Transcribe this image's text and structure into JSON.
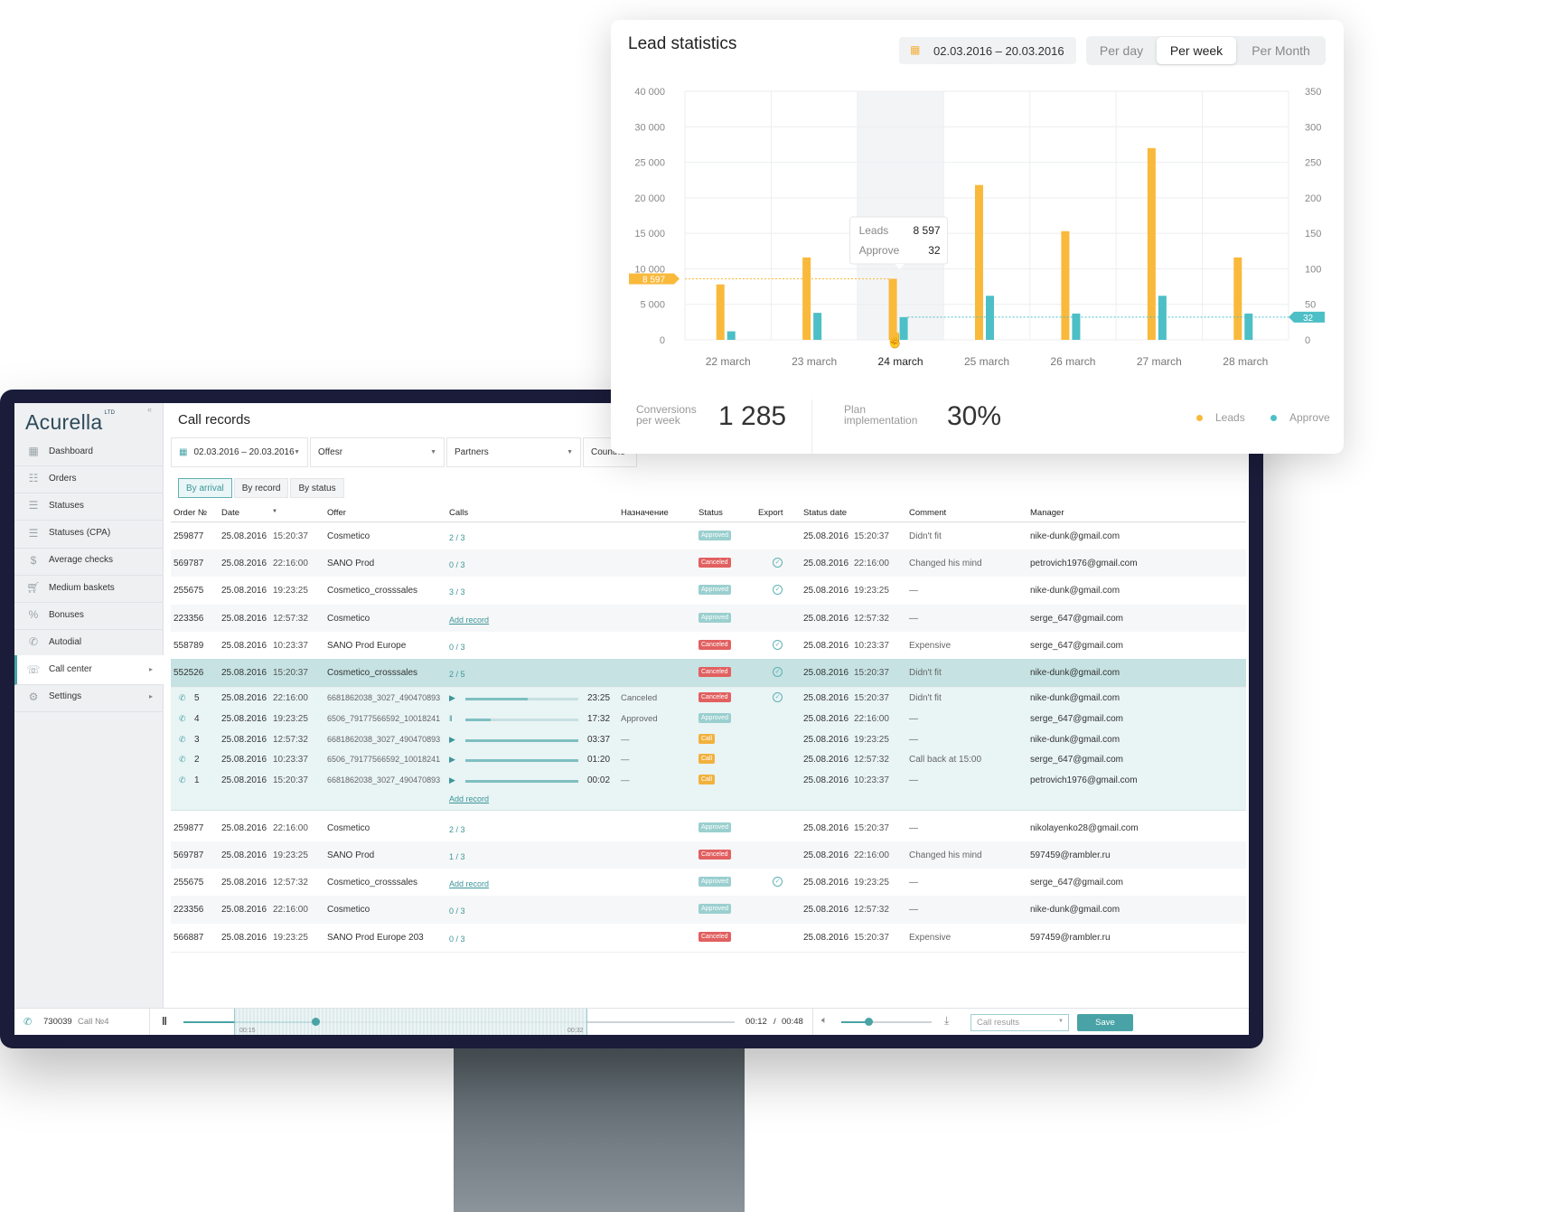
{
  "app": {
    "logo": "Acurella",
    "logo_sup": "LTD"
  },
  "sidebar": {
    "items": [
      {
        "label": "Dashboard",
        "icon": "grid-icon"
      },
      {
        "label": "Orders",
        "icon": "list-icon"
      },
      {
        "label": "Statuses",
        "icon": "lines-icon"
      },
      {
        "label": "Statuses (CPA)",
        "icon": "lines-icon"
      },
      {
        "label": "Average checks",
        "icon": "dollar-icon"
      },
      {
        "label": "Medium baskets",
        "icon": "cart-icon"
      },
      {
        "label": "Bonuses",
        "icon": "percent-icon"
      },
      {
        "label": "Autodial",
        "icon": "phone-icon"
      },
      {
        "label": "Call center",
        "icon": "headset-icon"
      },
      {
        "label": "Settings",
        "icon": "gear-icon"
      }
    ]
  },
  "page": {
    "title": "Call records"
  },
  "filters": {
    "date": "02.03.2016 – 20.03.2016",
    "offer": "Offesr",
    "partners": "Partners",
    "countries": "Countrie"
  },
  "tabs": [
    "By arrival",
    "By record",
    "By status"
  ],
  "table": {
    "headers": [
      "Order №",
      "Date",
      "Offer",
      "Calls",
      "Назначение",
      "Status",
      "Export",
      "Status date",
      "Comment",
      "Manager"
    ],
    "rows": [
      {
        "id": "259877",
        "date": "25.08.2016",
        "time": "15:20:37",
        "offer": "Cosmetico",
        "calls": "2 / 3",
        "status": "Approved",
        "export": false,
        "sdate": "25.08.2016",
        "stime": "15:20:37",
        "comment": "Didn't fit",
        "manager": "nike-dunk@gmail.com"
      },
      {
        "id": "569787",
        "date": "25.08.2016",
        "time": "22:16:00",
        "offer": "SANO Prod",
        "calls": "0 / 3",
        "status": "Canceled",
        "export": true,
        "sdate": "25.08.2016",
        "stime": "22:16:00",
        "comment": "Changed his mind",
        "manager": "petrovich1976@gmail.com"
      },
      {
        "id": "255675",
        "date": "25.08.2016",
        "time": "19:23:25",
        "offer": "Cosmetico_crosssales",
        "calls": "3 / 3",
        "status": "Approved",
        "export": true,
        "sdate": "25.08.2016",
        "stime": "19:23:25",
        "comment": "—",
        "manager": "nike-dunk@gmail.com"
      },
      {
        "id": "223356",
        "date": "25.08.2016",
        "time": "12:57:32",
        "offer": "Cosmetico",
        "calls": "Add record",
        "status": "Approved",
        "export": false,
        "sdate": "25.08.2016",
        "stime": "12:57:32",
        "comment": "—",
        "manager": "serge_647@gmail.com"
      },
      {
        "id": "558789",
        "date": "25.08.2016",
        "time": "10:23:37",
        "offer": "SANO Prod Europe",
        "calls": "0 / 3",
        "status": "Canceled",
        "export": true,
        "sdate": "25.08.2016",
        "stime": "10:23:37",
        "comment": "Expensive",
        "manager": "serge_647@gmail.com"
      },
      {
        "id": "552526",
        "date": "25.08.2016",
        "time": "15:20:37",
        "offer": "Cosmetico_crosssales",
        "calls": "2 / 5",
        "status": "Canceled",
        "export": true,
        "sdate": "25.08.2016",
        "stime": "15:20:37",
        "comment": "Didn't fit",
        "manager": "nike-dunk@gmail.com"
      }
    ],
    "subrows": [
      {
        "n": "5",
        "date": "25.08.2016",
        "time": "22:16:00",
        "file": "6681862038_3027_490470893",
        "dur": "23:25",
        "result": "Canceled",
        "status": "Canceled",
        "export": true,
        "sdate": "25.08.2016",
        "stime": "15:20:37",
        "comment": "Didn't fit",
        "manager": "nike-dunk@gmail.com",
        "progress": 0.55,
        "playing": false
      },
      {
        "n": "4",
        "date": "25.08.2016",
        "time": "19:23:25",
        "file": "6506_79177566592_10018241",
        "dur": "17:32",
        "result": "Approved",
        "status": "Approved",
        "export": false,
        "sdate": "25.08.2016",
        "stime": "22:16:00",
        "comment": "—",
        "manager": "serge_647@gmail.com",
        "progress": 0.22,
        "playing": true
      },
      {
        "n": "3",
        "date": "25.08.2016",
        "time": "12:57:32",
        "file": "6681862038_3027_490470893",
        "dur": "03:37",
        "result": "—",
        "status": "Call",
        "export": false,
        "sdate": "25.08.2016",
        "stime": "19:23:25",
        "comment": "—",
        "manager": "nike-dunk@gmail.com",
        "progress": 1,
        "playing": false
      },
      {
        "n": "2",
        "date": "25.08.2016",
        "time": "10:23:37",
        "file": "6506_79177566592_10018241",
        "dur": "01:20",
        "result": "—",
        "status": "Call",
        "export": false,
        "sdate": "25.08.2016",
        "stime": "12:57:32",
        "comment": "Call back at 15:00",
        "manager": "serge_647@gmail.com",
        "progress": 1,
        "playing": false
      },
      {
        "n": "1",
        "date": "25.08.2016",
        "time": "15:20:37",
        "file": "6681862038_3027_490470893",
        "dur": "00:02",
        "result": "—",
        "status": "Call",
        "export": false,
        "sdate": "25.08.2016",
        "stime": "10:23:37",
        "comment": "—",
        "manager": "petrovich1976@gmail.com",
        "progress": 1,
        "playing": false
      }
    ],
    "sub_add": "Add record",
    "rows2": [
      {
        "id": "259877",
        "date": "25.08.2016",
        "time": "22:16:00",
        "offer": "Cosmetico",
        "calls": "2 / 3",
        "status": "Approved",
        "export": false,
        "sdate": "25.08.2016",
        "stime": "15:20:37",
        "comment": "—",
        "manager": "nikolayenko28@gmail.com"
      },
      {
        "id": "569787",
        "date": "25.08.2016",
        "time": "19:23:25",
        "offer": "SANO Prod",
        "calls": "1 / 3",
        "status": "Canceled",
        "export": false,
        "sdate": "25.08.2016",
        "stime": "22:16:00",
        "comment": "Changed his mind",
        "manager": "597459@rambler.ru"
      },
      {
        "id": "255675",
        "date": "25.08.2016",
        "time": "12:57:32",
        "offer": "Cosmetico_crosssales",
        "calls": "Add record",
        "status": "Approved",
        "export": true,
        "sdate": "25.08.2016",
        "stime": "19:23:25",
        "comment": "—",
        "manager": "serge_647@gmail.com"
      },
      {
        "id": "223356",
        "date": "25.08.2016",
        "time": "22:16:00",
        "offer": "Cosmetico",
        "calls": "0 / 3",
        "status": "Approved",
        "export": false,
        "sdate": "25.08.2016",
        "stime": "12:57:32",
        "comment": "—",
        "manager": "nike-dunk@gmail.com"
      },
      {
        "id": "566887",
        "date": "25.08.2016",
        "time": "19:23:25",
        "offer": "SANO Prod Europe 203",
        "calls": "0 / 3",
        "status": "Canceled",
        "export": false,
        "sdate": "25.08.2016",
        "stime": "15:20:37",
        "comment": "Expensive",
        "manager": "597459@rambler.ru"
      }
    ]
  },
  "player": {
    "number": "730039",
    "call": "Call №4",
    "current": "00:12",
    "sep": "/",
    "total": "00:48",
    "mark_start": "00:15",
    "mark_end": "00:32",
    "results_placeholder": "Call results",
    "save": "Save",
    "progress": 0.24,
    "volume": 0.3
  },
  "stats_card": {
    "title": "Lead statistics",
    "date_range": "02.03.2016 – 20.03.2016",
    "periods": [
      "Per day",
      "Per week",
      "Per Month"
    ],
    "selected_period": "Per week",
    "conv_label": "Conversions per week",
    "conv_value": "1 285",
    "plan_label": "Plan implementation",
    "plan_value": "30%",
    "tooltip": {
      "leads_label": "Leads",
      "leads_value": "8 597",
      "approve_label": "Approve",
      "approve_value": "32"
    },
    "marker_left": "8 597",
    "marker_right": "32"
  },
  "chart_data": {
    "type": "bar",
    "categories": [
      "22 march",
      "23 march",
      "24 march",
      "25 march",
      "26 march",
      "27 march",
      "28 march"
    ],
    "highlighted": "24 march",
    "series": [
      {
        "name": "Leads",
        "axis": "left",
        "color": "#f9b93b",
        "values": [
          7800,
          11600,
          8597,
          21800,
          15300,
          27000,
          11600
        ]
      },
      {
        "name": "Approve",
        "axis": "right",
        "color": "#4dbfc6",
        "values": [
          12,
          38,
          32,
          62,
          37,
          62,
          37
        ]
      }
    ],
    "y_left": {
      "ticks": [
        "0",
        "5 000",
        "10 000",
        "15 000",
        "20 000",
        "25 000",
        "30 000",
        "40 000"
      ]
    },
    "y_right": {
      "ticks": [
        "0",
        "50",
        "100",
        "150",
        "200",
        "250",
        "300",
        "350"
      ]
    },
    "legend": "bottom-right",
    "grid": true
  },
  "colors": {
    "accent": "#49a3a6",
    "approved": "#9bcfcf",
    "canceled": "#e26060",
    "call": "#f2b13c",
    "bezel": "#1a1c39"
  }
}
